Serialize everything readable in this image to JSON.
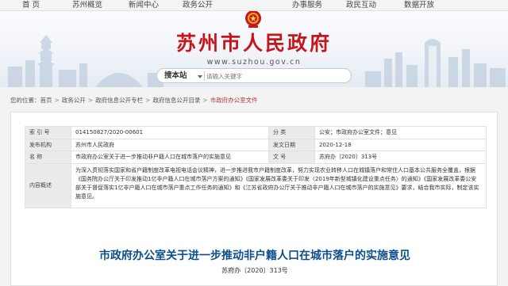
{
  "topnav": {
    "items": [
      "首 页",
      "苏州概览",
      "新闻中心",
      "政务公开",
      "",
      "办事服务",
      "政民互动",
      "数据开放"
    ]
  },
  "header": {
    "site_title": "苏州市人民政府",
    "site_url": "www.suzhou.gov.cn",
    "search": {
      "label": "搜本站",
      "placeholder": "请输入关键字"
    }
  },
  "breadcrumb": {
    "prefix": "您的位置：",
    "items": [
      "首页",
      "政务公开",
      "政府信息公开专栏",
      "政府信息公开目录",
      "市政府办公室文件"
    ]
  },
  "meta": {
    "index_label": "索 引 号",
    "index_value": "014150827/2020-00601",
    "category_label": "分 类",
    "category_value": "公安；市政府办公室文件；意见",
    "issuer_label": "发布机构",
    "issuer_value": "苏州市人民政府",
    "date_label": "发文日期",
    "date_value": "2020-12-18",
    "name_label": "名 称",
    "name_value": "市政府办公室关于进一步推动非户籍人口在城市落户的实施意见",
    "docno_label": "文 号",
    "docno_value": "苏府办〔2020〕313号",
    "summary_label": "内容概述",
    "summary_value": "为深入贯彻落实国家和省户籍制度改革电视电话会议精神，进一步推进我市户籍制度改革，努力实现农业转移人口在城镇落户和常住人口基本公共服务全覆盖，根据《国务院办公厅关于印发推动1亿非户籍人口在城市落户方案的通知》《国家发展改革委关于印发〈2019年新型城镇化建设重点任务〉的通知》《国家发展改革委公安部关于督促落实1亿非户籍人口在城市落户重点工作任务的通知》和《江苏省政府办公厅关于推动非户籍人口在城市落户的实施意见》要求，结合我市实际，制定该实施意见。"
  },
  "article": {
    "title": "市政府办公室关于进一步推动非户籍人口在城市落户的实施意见",
    "doc_number": "苏府办〔2020〕313号"
  }
}
